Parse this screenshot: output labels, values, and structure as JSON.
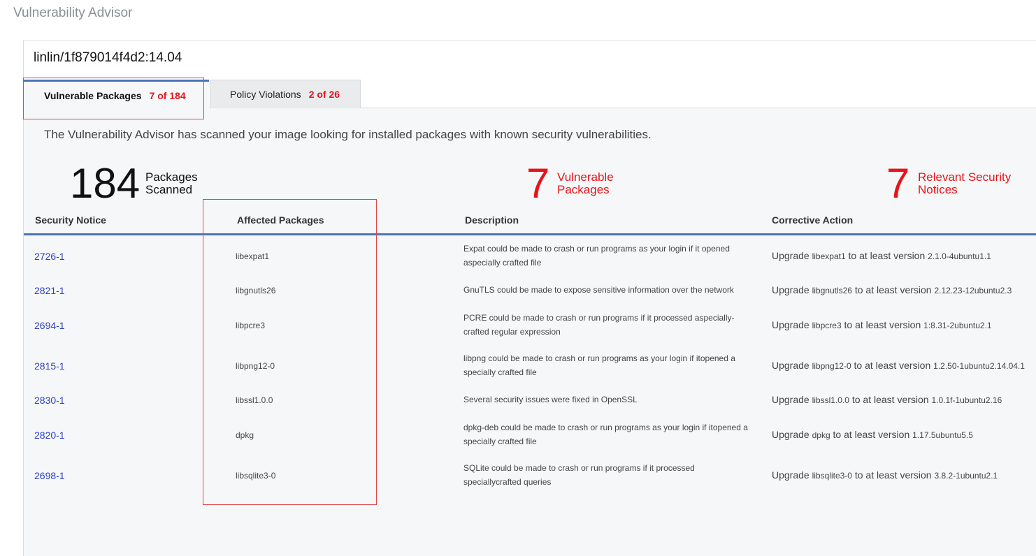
{
  "app": {
    "title": "Vulnerability Advisor"
  },
  "image": {
    "name": "linlin/1f879014f4d2:14.04"
  },
  "tabs": [
    {
      "label": "Vulnerable Packages",
      "count": "7 of 184"
    },
    {
      "label": "Policy Violations",
      "count": "2 of 26"
    }
  ],
  "intro": "The Vulnerability Advisor has scanned your image looking for installed packages with known security vulnerabilities.",
  "stats": {
    "scanned": {
      "value": "184",
      "label_line1": "Packages",
      "label_line2": "Scanned"
    },
    "vulnerable": {
      "value": "7",
      "label_line1": "Vulnerable",
      "label_line2": "Packages"
    },
    "notices": {
      "value": "7",
      "label_line1": "Relevant Security",
      "label_line2": "Notices"
    }
  },
  "colors": {
    "accent": "#4a74b8",
    "alert": "#e8141a",
    "link": "#2a3fc5"
  },
  "table": {
    "headers": [
      "Security Notice",
      "Affected Packages",
      "Description",
      "Corrective Action"
    ],
    "action_prefix": "Upgrade",
    "action_middle": "to at least version",
    "rows": [
      {
        "notice": "2726-1",
        "package": "libexpat1",
        "desc1": "Expat could be made to crash or run programs as your login if it opened",
        "desc2": "aspecially crafted file",
        "version": "2.1.0-4ubuntu1.1"
      },
      {
        "notice": "2821-1",
        "package": "libgnutls26",
        "desc1": "GnuTLS could be made to expose sensitive information over the network",
        "desc2": "",
        "version": "2.12.23-12ubuntu2.3"
      },
      {
        "notice": "2694-1",
        "package": "libpcre3",
        "desc1": "PCRE could be made to crash or run programs if it processed aspecially-",
        "desc2": "crafted regular expression",
        "version": "1:8.31-2ubuntu2.1"
      },
      {
        "notice": "2815-1",
        "package": "libpng12-0",
        "desc1": "libpng could be made to crash or run programs as your login if itopened a",
        "desc2": "specially crafted file",
        "version": "1.2.50-1ubuntu2.14.04.1"
      },
      {
        "notice": "2830-1",
        "package": "libssl1.0.0",
        "desc1": "Several security issues were fixed in OpenSSL",
        "desc2": "",
        "version": "1.0.1f-1ubuntu2.16"
      },
      {
        "notice": "2820-1",
        "package": "dpkg",
        "desc1": "dpkg-deb could be made to crash or run programs as your login if itopened a",
        "desc2": "specially crafted file",
        "version": "1.17.5ubuntu5.5"
      },
      {
        "notice": "2698-1",
        "package": "libsqlite3-0",
        "desc1": "SQLite could be made to crash or run programs if it processed",
        "desc2": "speciallycrafted queries",
        "version": "3.8.2-1ubuntu2.1"
      }
    ]
  }
}
